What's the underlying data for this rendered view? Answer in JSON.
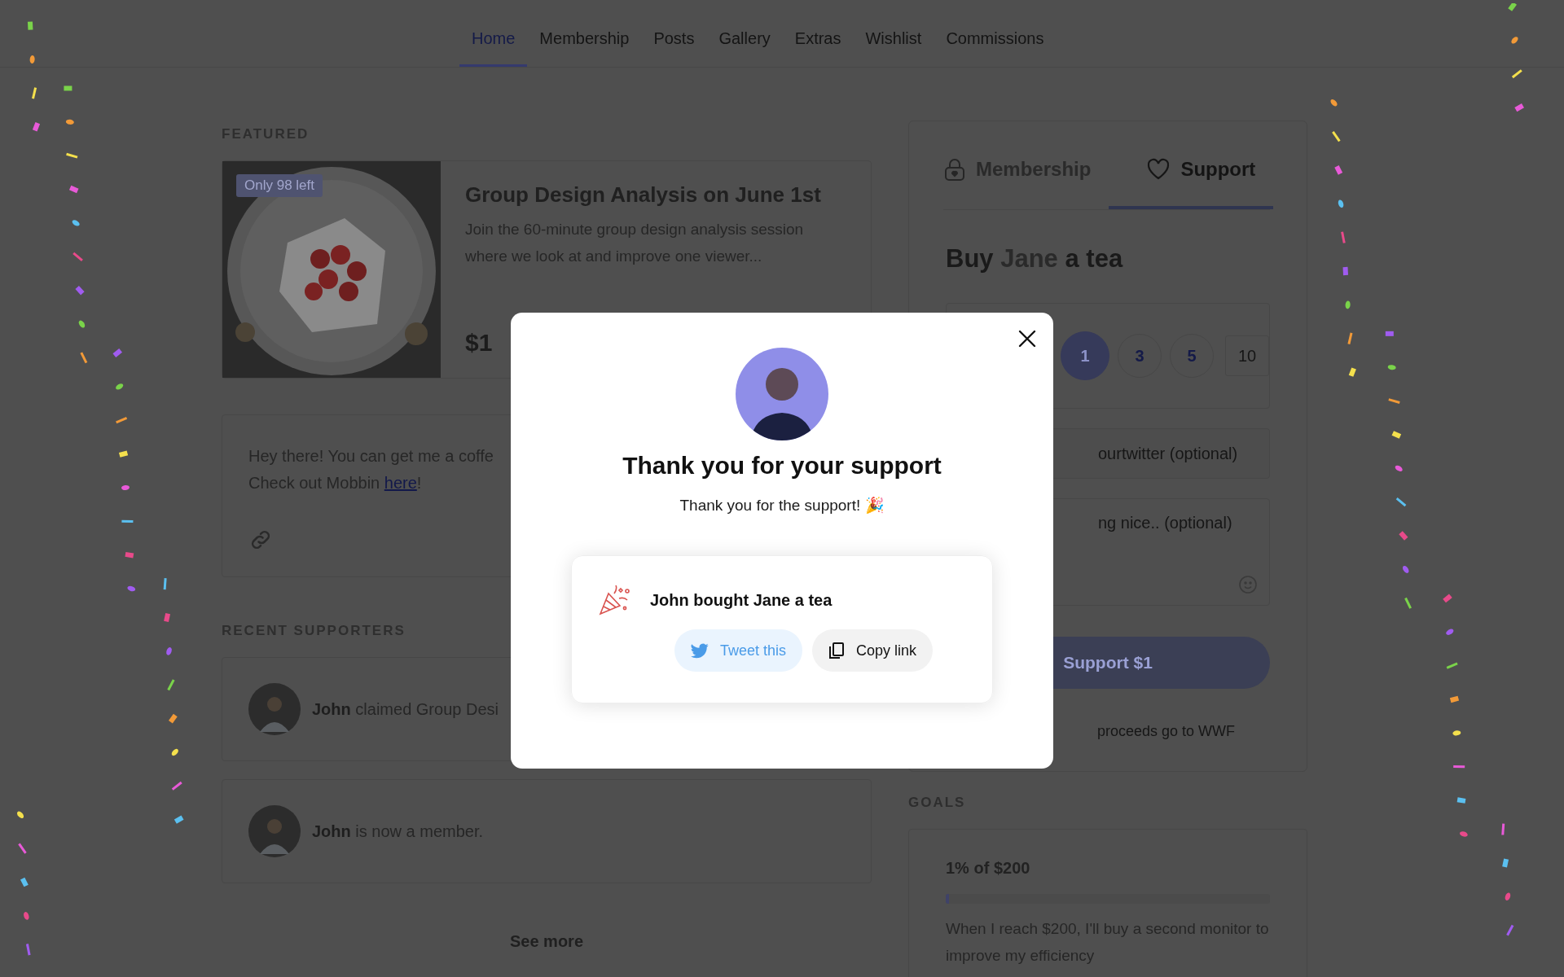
{
  "nav": {
    "tabs": [
      {
        "label": "Home",
        "selected": true
      },
      {
        "label": "Membership",
        "selected": false
      },
      {
        "label": "Posts",
        "selected": false
      },
      {
        "label": "Gallery",
        "selected": false
      },
      {
        "label": "Extras",
        "selected": false
      },
      {
        "label": "Wishlist",
        "selected": false
      },
      {
        "label": "Commissions",
        "selected": false
      }
    ]
  },
  "featured": {
    "heading": "FEATURED",
    "badge": "Only 98 left",
    "title": "Group Design Analysis on June 1st",
    "description": "Join the 60-minute group design analysis session where we look at and improve one viewer...",
    "price": "$1"
  },
  "note": {
    "lines": [
      "Hey there! You can get me a coffe"
    ],
    "link_line": {
      "before": "Check out Mobbin ",
      "link": "here",
      "after": "!"
    }
  },
  "recent_supporters": {
    "heading": "RECENT SUPPORTERS",
    "items": [
      {
        "name": "John",
        "text": " claimed Group Desi"
      },
      {
        "name": "John",
        "text": " is now a member."
      }
    ],
    "see_more": "See more"
  },
  "support_panel": {
    "tabs": [
      {
        "label": "Membership",
        "kind": "lock",
        "selected": false
      },
      {
        "label": "Support",
        "kind": "heart",
        "selected": true
      }
    ],
    "title": {
      "before": "Buy ",
      "name": "Jane",
      "after": " a tea"
    },
    "amounts": [
      {
        "label": "1",
        "kind": "circle",
        "selected": true
      },
      {
        "label": "3",
        "kind": "circle",
        "selected": false
      },
      {
        "label": "5",
        "kind": "circle",
        "selected": false
      },
      {
        "label": "10",
        "kind": "box",
        "selected": false
      }
    ],
    "twitter_placeholder": "ourtwitter (optional)",
    "message_placeholder": "ng nice.. (optional)",
    "button": "Support $1",
    "note": "proceeds go to WWF"
  },
  "goals": {
    "heading": "GOALS",
    "items": [
      {
        "title": "1% of $200",
        "level": 0.01,
        "description": "When I reach $200, I'll buy a second monitor to improve my efficiency"
      }
    ]
  },
  "modal": {
    "title": "Thank you for your support",
    "message": "Thank you for the support! 🎉",
    "card": {
      "text": "John bought Jane a tea",
      "buttons": [
        {
          "label": "Tweet this",
          "kind": "tweet"
        },
        {
          "label": "Copy link",
          "kind": "copy"
        }
      ]
    }
  }
}
